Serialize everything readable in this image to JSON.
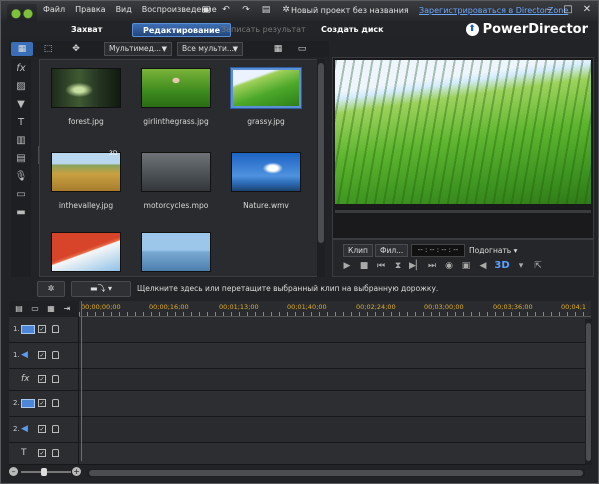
{
  "menu": [
    "Файл",
    "Правка",
    "Вид",
    "Воспроизведение"
  ],
  "project_title": "Новый проект без названия",
  "register_link": "Зарегистрироваться в DirectorZone",
  "modes": {
    "capture": "Захват",
    "edit": "Редактирование",
    "produce": "Записать результат",
    "disc": "Создать диск"
  },
  "brand": "PowerDirector",
  "library": {
    "filter_media": "Мультимед...",
    "filter_all": "Все мульти...",
    "items": [
      {
        "name": "forest.jpg"
      },
      {
        "name": "girlinthegrass.jpg"
      },
      {
        "name": "grassy.jpg",
        "selected": true
      },
      {
        "name": "inthevalley.jpg"
      },
      {
        "name": "motorcycles.mpo",
        "badge": "3D"
      },
      {
        "name": "Nature.wmv"
      },
      {
        "name": ""
      },
      {
        "name": ""
      }
    ]
  },
  "preview": {
    "tab_clip": "Клип",
    "tab_film": "Фил...",
    "timecode": "-- : -- : -- : --",
    "fit": "Подогнать",
    "mode_3d": "3D"
  },
  "timeline": {
    "hint": "Щелкните здесь или перетащите выбранный клип на выбранную дорожку.",
    "ruler": [
      "00;00;00;00",
      "00;00;16;00",
      "00;01;13;00",
      "00;01;40;00",
      "00;02;24;00",
      "00;03;00;00",
      "00;03;36;00",
      "00;04;1"
    ],
    "tracks": [
      {
        "num": "1.",
        "type": "video"
      },
      {
        "num": "1.",
        "type": "audio"
      },
      {
        "num": "",
        "type": "fx"
      },
      {
        "num": "2.",
        "type": "video"
      },
      {
        "num": "2.",
        "type": "audio"
      },
      {
        "num": "",
        "type": "title"
      },
      {
        "num": "",
        "type": "voice"
      }
    ]
  },
  "colors": {
    "accent": "#3a6fb8",
    "ruler_text": "#e0b030",
    "link": "#6aa8ff"
  }
}
